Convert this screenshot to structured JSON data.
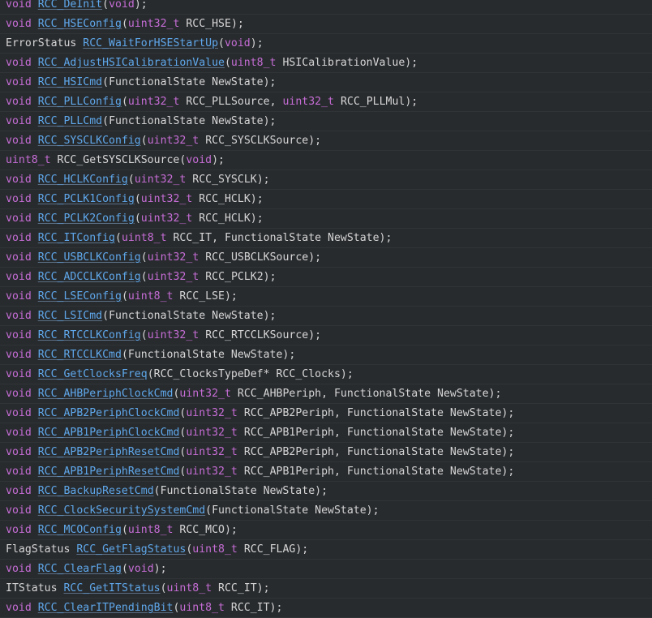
{
  "editor": {
    "colors": {
      "background": "#282b2e",
      "keyword": "#c66dd6",
      "function": "#5fa8ec",
      "text": "#d6d6d6",
      "row_separator": "#313437"
    },
    "lines": [
      [
        {
          "t": "void",
          "c": "kw"
        },
        {
          "t": " ",
          "c": "punc"
        },
        {
          "t": "RCC_DeInit",
          "c": "fn"
        },
        {
          "t": "(",
          "c": "punc"
        },
        {
          "t": "void",
          "c": "kw"
        },
        {
          "t": ");",
          "c": "punc"
        }
      ],
      [
        {
          "t": "void",
          "c": "kw"
        },
        {
          "t": " ",
          "c": "punc"
        },
        {
          "t": "RCC_HSEConfig",
          "c": "fn"
        },
        {
          "t": "(",
          "c": "punc"
        },
        {
          "t": "uint32_t",
          "c": "kw"
        },
        {
          "t": " RCC_HSE);",
          "c": "param"
        }
      ],
      [
        {
          "t": "ErrorStatus",
          "c": "type"
        },
        {
          "t": " ",
          "c": "punc"
        },
        {
          "t": "RCC_WaitForHSEStartUp",
          "c": "fn"
        },
        {
          "t": "(",
          "c": "punc"
        },
        {
          "t": "void",
          "c": "kw"
        },
        {
          "t": ");",
          "c": "punc"
        }
      ],
      [
        {
          "t": "void",
          "c": "kw"
        },
        {
          "t": " ",
          "c": "punc"
        },
        {
          "t": "RCC_AdjustHSICalibrationValue",
          "c": "fn"
        },
        {
          "t": "(",
          "c": "punc"
        },
        {
          "t": "uint8_t",
          "c": "kw"
        },
        {
          "t": " HSICalibrationValue);",
          "c": "param"
        }
      ],
      [
        {
          "t": "void",
          "c": "kw"
        },
        {
          "t": " ",
          "c": "punc"
        },
        {
          "t": "RCC_HSICmd",
          "c": "fn"
        },
        {
          "t": "(FunctionalState NewState);",
          "c": "param"
        }
      ],
      [
        {
          "t": "void",
          "c": "kw"
        },
        {
          "t": " ",
          "c": "punc"
        },
        {
          "t": "RCC_PLLConfig",
          "c": "fn"
        },
        {
          "t": "(",
          "c": "punc"
        },
        {
          "t": "uint32_t",
          "c": "kw"
        },
        {
          "t": " RCC_PLLSource, ",
          "c": "param"
        },
        {
          "t": "uint32_t",
          "c": "kw"
        },
        {
          "t": " RCC_PLLMul);",
          "c": "param"
        }
      ],
      [
        {
          "t": "void",
          "c": "kw"
        },
        {
          "t": " ",
          "c": "punc"
        },
        {
          "t": "RCC_PLLCmd",
          "c": "fn"
        },
        {
          "t": "(FunctionalState NewState);",
          "c": "param"
        }
      ],
      [
        {
          "t": "void",
          "c": "kw"
        },
        {
          "t": " ",
          "c": "punc"
        },
        {
          "t": "RCC_SYSCLKConfig",
          "c": "fn"
        },
        {
          "t": "(",
          "c": "punc"
        },
        {
          "t": "uint32_t",
          "c": "kw"
        },
        {
          "t": " RCC_SYSCLKSource);",
          "c": "param"
        }
      ],
      [
        {
          "t": "uint8_t",
          "c": "kw"
        },
        {
          "t": " RCC_GetSYSCLKSource(",
          "c": "type"
        },
        {
          "t": "void",
          "c": "kw"
        },
        {
          "t": ");",
          "c": "punc"
        }
      ],
      [
        {
          "t": "void",
          "c": "kw"
        },
        {
          "t": " ",
          "c": "punc"
        },
        {
          "t": "RCC_HCLKConfig",
          "c": "fn"
        },
        {
          "t": "(",
          "c": "punc"
        },
        {
          "t": "uint32_t",
          "c": "kw"
        },
        {
          "t": " RCC_SYSCLK);",
          "c": "param"
        }
      ],
      [
        {
          "t": "void",
          "c": "kw"
        },
        {
          "t": " ",
          "c": "punc"
        },
        {
          "t": "RCC_PCLK1Config",
          "c": "fn"
        },
        {
          "t": "(",
          "c": "punc"
        },
        {
          "t": "uint32_t",
          "c": "kw"
        },
        {
          "t": " RCC_HCLK);",
          "c": "param"
        }
      ],
      [
        {
          "t": "void",
          "c": "kw"
        },
        {
          "t": " ",
          "c": "punc"
        },
        {
          "t": "RCC_PCLK2Config",
          "c": "fn"
        },
        {
          "t": "(",
          "c": "punc"
        },
        {
          "t": "uint32_t",
          "c": "kw"
        },
        {
          "t": " RCC_HCLK);",
          "c": "param"
        }
      ],
      [
        {
          "t": "void",
          "c": "kw"
        },
        {
          "t": " ",
          "c": "punc"
        },
        {
          "t": "RCC_ITConfig",
          "c": "fn"
        },
        {
          "t": "(",
          "c": "punc"
        },
        {
          "t": "uint8_t",
          "c": "kw"
        },
        {
          "t": " RCC_IT, FunctionalState NewState);",
          "c": "param"
        }
      ],
      [
        {
          "t": "void",
          "c": "kw"
        },
        {
          "t": " ",
          "c": "punc"
        },
        {
          "t": "RCC_USBCLKConfig",
          "c": "fn"
        },
        {
          "t": "(",
          "c": "punc"
        },
        {
          "t": "uint32_t",
          "c": "kw"
        },
        {
          "t": " RCC_USBCLKSource);",
          "c": "param"
        }
      ],
      [
        {
          "t": "void",
          "c": "kw"
        },
        {
          "t": " ",
          "c": "punc"
        },
        {
          "t": "RCC_ADCCLKConfig",
          "c": "fn"
        },
        {
          "t": "(",
          "c": "punc"
        },
        {
          "t": "uint32_t",
          "c": "kw"
        },
        {
          "t": " RCC_PCLK2);",
          "c": "param"
        }
      ],
      [
        {
          "t": "void",
          "c": "kw"
        },
        {
          "t": " ",
          "c": "punc"
        },
        {
          "t": "RCC_LSEConfig",
          "c": "fn"
        },
        {
          "t": "(",
          "c": "punc"
        },
        {
          "t": "uint8_t",
          "c": "kw"
        },
        {
          "t": " RCC_LSE);",
          "c": "param"
        }
      ],
      [
        {
          "t": "void",
          "c": "kw"
        },
        {
          "t": " ",
          "c": "punc"
        },
        {
          "t": "RCC_LSICmd",
          "c": "fn"
        },
        {
          "t": "(FunctionalState NewState);",
          "c": "param"
        }
      ],
      [
        {
          "t": "void",
          "c": "kw"
        },
        {
          "t": " ",
          "c": "punc"
        },
        {
          "t": "RCC_RTCCLKConfig",
          "c": "fn"
        },
        {
          "t": "(",
          "c": "punc"
        },
        {
          "t": "uint32_t",
          "c": "kw"
        },
        {
          "t": " RCC_RTCCLKSource);",
          "c": "param"
        }
      ],
      [
        {
          "t": "void",
          "c": "kw"
        },
        {
          "t": " ",
          "c": "punc"
        },
        {
          "t": "RCC_RTCCLKCmd",
          "c": "fn"
        },
        {
          "t": "(FunctionalState NewState);",
          "c": "param"
        }
      ],
      [
        {
          "t": "void",
          "c": "kw"
        },
        {
          "t": " ",
          "c": "punc"
        },
        {
          "t": "RCC_GetClocksFreq",
          "c": "fn"
        },
        {
          "t": "(RCC_ClocksTypeDef* RCC_Clocks);",
          "c": "param"
        }
      ],
      [
        {
          "t": "void",
          "c": "kw"
        },
        {
          "t": " ",
          "c": "punc"
        },
        {
          "t": "RCC_AHBPeriphClockCmd",
          "c": "fn"
        },
        {
          "t": "(",
          "c": "punc"
        },
        {
          "t": "uint32_t",
          "c": "kw"
        },
        {
          "t": " RCC_AHBPeriph, FunctionalState NewState);",
          "c": "param"
        }
      ],
      [
        {
          "t": "void",
          "c": "kw"
        },
        {
          "t": " ",
          "c": "punc"
        },
        {
          "t": "RCC_APB2PeriphClockCmd",
          "c": "fn"
        },
        {
          "t": "(",
          "c": "punc"
        },
        {
          "t": "uint32_t",
          "c": "kw"
        },
        {
          "t": " RCC_APB2Periph, FunctionalState NewState);",
          "c": "param"
        }
      ],
      [
        {
          "t": "void",
          "c": "kw"
        },
        {
          "t": " ",
          "c": "punc"
        },
        {
          "t": "RCC_APB1PeriphClockCmd",
          "c": "fn"
        },
        {
          "t": "(",
          "c": "punc"
        },
        {
          "t": "uint32_t",
          "c": "kw"
        },
        {
          "t": " RCC_APB1Periph, FunctionalState NewState);",
          "c": "param"
        }
      ],
      [
        {
          "t": "void",
          "c": "kw"
        },
        {
          "t": " ",
          "c": "punc"
        },
        {
          "t": "RCC_APB2PeriphResetCmd",
          "c": "fn"
        },
        {
          "t": "(",
          "c": "punc"
        },
        {
          "t": "uint32_t",
          "c": "kw"
        },
        {
          "t": " RCC_APB2Periph, FunctionalState NewState);",
          "c": "param"
        }
      ],
      [
        {
          "t": "void",
          "c": "kw"
        },
        {
          "t": " ",
          "c": "punc"
        },
        {
          "t": "RCC_APB1PeriphResetCmd",
          "c": "fn"
        },
        {
          "t": "(",
          "c": "punc"
        },
        {
          "t": "uint32_t",
          "c": "kw"
        },
        {
          "t": " RCC_APB1Periph, FunctionalState NewState);",
          "c": "param"
        }
      ],
      [
        {
          "t": "void",
          "c": "kw"
        },
        {
          "t": " ",
          "c": "punc"
        },
        {
          "t": "RCC_BackupResetCmd",
          "c": "fn"
        },
        {
          "t": "(FunctionalState NewState);",
          "c": "param"
        }
      ],
      [
        {
          "t": "void",
          "c": "kw"
        },
        {
          "t": " ",
          "c": "punc"
        },
        {
          "t": "RCC_ClockSecuritySystemCmd",
          "c": "fn"
        },
        {
          "t": "(FunctionalState NewState);",
          "c": "param"
        }
      ],
      [
        {
          "t": "void",
          "c": "kw"
        },
        {
          "t": " ",
          "c": "punc"
        },
        {
          "t": "RCC_MCOConfig",
          "c": "fn"
        },
        {
          "t": "(",
          "c": "punc"
        },
        {
          "t": "uint8_t",
          "c": "kw"
        },
        {
          "t": " RCC_MCO);",
          "c": "param"
        }
      ],
      [
        {
          "t": "FlagStatus",
          "c": "type"
        },
        {
          "t": " ",
          "c": "punc"
        },
        {
          "t": "RCC_GetFlagStatus",
          "c": "fn"
        },
        {
          "t": "(",
          "c": "punc"
        },
        {
          "t": "uint8_t",
          "c": "kw"
        },
        {
          "t": " RCC_FLAG);",
          "c": "param"
        }
      ],
      [
        {
          "t": "void",
          "c": "kw"
        },
        {
          "t": " ",
          "c": "punc"
        },
        {
          "t": "RCC_ClearFlag",
          "c": "fn"
        },
        {
          "t": "(",
          "c": "punc"
        },
        {
          "t": "void",
          "c": "kw"
        },
        {
          "t": ");",
          "c": "punc"
        }
      ],
      [
        {
          "t": "ITStatus",
          "c": "type"
        },
        {
          "t": " ",
          "c": "punc"
        },
        {
          "t": "RCC_GetITStatus",
          "c": "fn"
        },
        {
          "t": "(",
          "c": "punc"
        },
        {
          "t": "uint8_t",
          "c": "kw"
        },
        {
          "t": " RCC_IT);",
          "c": "param"
        }
      ],
      [
        {
          "t": "void",
          "c": "kw"
        },
        {
          "t": " ",
          "c": "punc"
        },
        {
          "t": "RCC_ClearITPendingBit",
          "c": "fn"
        },
        {
          "t": "(",
          "c": "punc"
        },
        {
          "t": "uint8_t",
          "c": "kw"
        },
        {
          "t": " RCC_IT);",
          "c": "param"
        }
      ]
    ]
  }
}
